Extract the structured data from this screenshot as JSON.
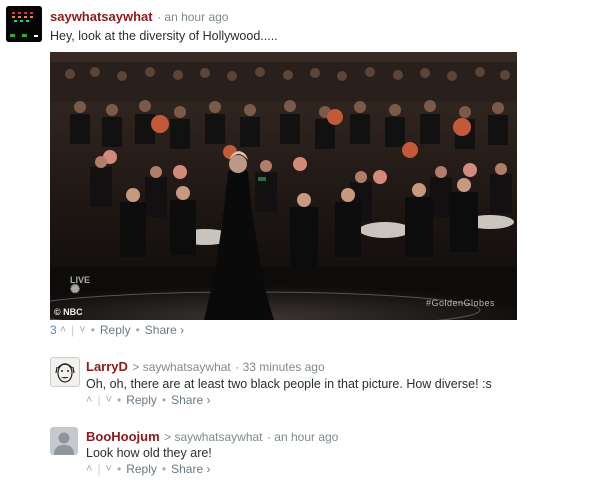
{
  "comments": [
    {
      "author": "saywhatsaywhat",
      "time": "an hour ago",
      "text": "Hey, look at the diversity of Hollywood.....",
      "image": {
        "watermark_left": "© NBC",
        "watermark_right": "#GoldenGlobes",
        "live_badge": "LIVE"
      },
      "actions": {
        "upvotes": "3",
        "reply": "Reply",
        "share": "Share ›"
      }
    },
    {
      "author": "LarryD",
      "reply_to": "> saywhatsaywhat",
      "time": "33 minutes ago",
      "text": "Oh, oh, there are at least two black people in that picture. How diverse! :s",
      "actions": {
        "reply": "Reply",
        "share": "Share ›"
      }
    },
    {
      "author": "BooHoojum",
      "reply_to": "> saywhatsaywhat",
      "time": "an hour ago",
      "text": "Look how old they are!",
      "actions": {
        "reply": "Reply",
        "share": "Share ›"
      }
    }
  ],
  "icons": {
    "upvote": "chevron-up-icon",
    "downvote": "chevron-down-icon"
  }
}
